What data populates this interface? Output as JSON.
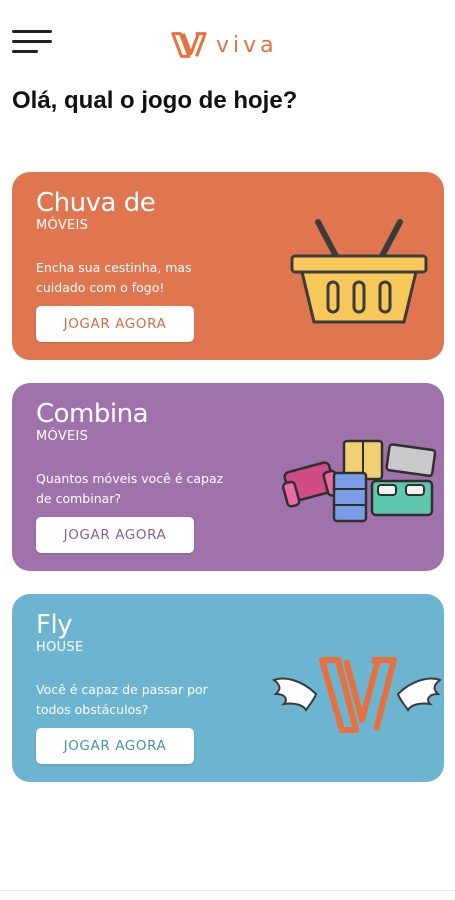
{
  "app": {
    "logo_text": "viva",
    "brand_color": "#e8703e"
  },
  "greeting": "Olá, qual o jogo de hoje?",
  "cards": [
    {
      "title": "Chuva de",
      "subtitle": "MÓVEIS",
      "description": "Encha sua cestinha, mas cuidado com o fogo!",
      "button_label": "JOGAR AGORA",
      "color": "#e07650",
      "icon": "basket-icon"
    },
    {
      "title": "Combina",
      "subtitle": "MÓVEIS",
      "description": "Quantos móveis você é capaz de combinar?",
      "button_label": "JOGAR AGORA",
      "color": "#a072ab",
      "icon": "furniture-icon"
    },
    {
      "title": "Fly",
      "subtitle": "HOUSE",
      "description": "Você é capaz de passar por todos obstáculos?",
      "button_label": "JOGAR AGORA",
      "color": "#6cb4d0",
      "icon": "winged-logo-icon"
    }
  ]
}
